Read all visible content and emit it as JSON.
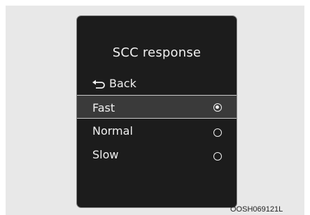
{
  "menu": {
    "title": "SCC response",
    "back_label": "Back",
    "options": [
      {
        "label": "Fast",
        "selected": true
      },
      {
        "label": "Normal",
        "selected": false
      },
      {
        "label": "Slow",
        "selected": false
      }
    ]
  },
  "caption": "OOSH069121L",
  "icons": {
    "back": "return-arrow-icon",
    "selected_radio": "radio-selected-icon",
    "radio": "radio-empty-icon"
  },
  "colors": {
    "panel_background": "#1c1c1c",
    "selected_row": "#3a3a3a",
    "text": "#f0f0f0"
  }
}
